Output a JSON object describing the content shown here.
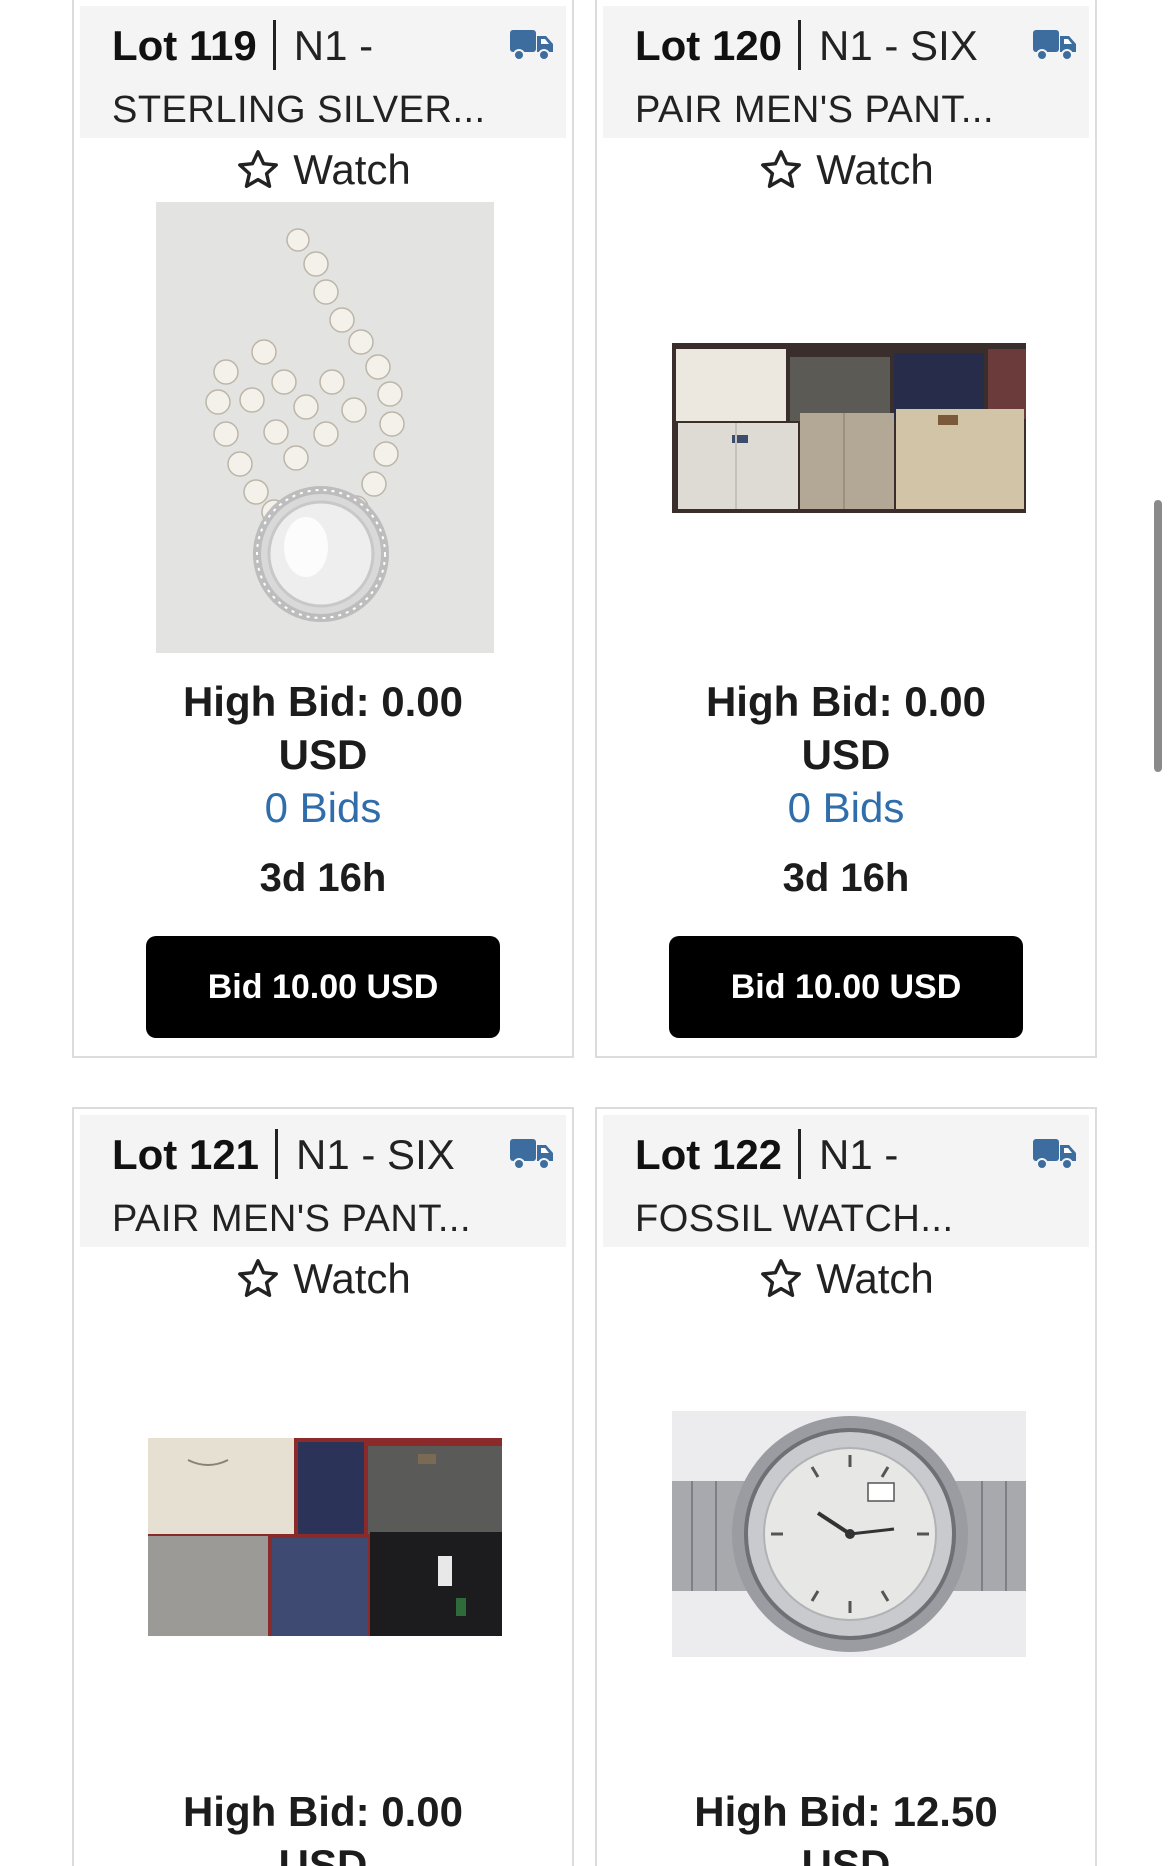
{
  "lots": [
    {
      "lot_label": "Lot 119",
      "prefix": "N1 -",
      "title": "STERLING SILVER...",
      "watch_label": "Watch",
      "high_bid": "High Bid: 0.00",
      "currency": "USD",
      "bids": "0 Bids",
      "time_left": "3d 16h",
      "button": "Bid 10.00 USD",
      "image": "pearl-necklace-photo"
    },
    {
      "lot_label": "Lot 120",
      "prefix": "N1 - SIX",
      "title": "PAIR MEN'S PANT...",
      "watch_label": "Watch",
      "high_bid": "High Bid: 0.00",
      "currency": "USD",
      "bids": "0 Bids",
      "time_left": "3d 16h",
      "button": "Bid 10.00 USD",
      "image": "mens-pants-photo"
    },
    {
      "lot_label": "Lot 121",
      "prefix": "N1 - SIX",
      "title": "PAIR MEN'S PANT...",
      "watch_label": "Watch",
      "high_bid": "High Bid: 0.00",
      "currency": "USD",
      "image": "mens-pants-photo"
    },
    {
      "lot_label": "Lot 122",
      "prefix": "N1 -",
      "title": "FOSSIL WATCH...",
      "watch_label": "Watch",
      "high_bid": "High Bid: 12.50",
      "currency": "USD",
      "image": "fossil-watch-photo"
    }
  ],
  "icons": {
    "shipping": "truck-icon",
    "watch": "star-icon"
  },
  "colors": {
    "accent_blue": "#2f6dab",
    "truck_blue": "#3d6d9e",
    "button_bg": "#000000",
    "header_bg": "#f4f4f4"
  }
}
